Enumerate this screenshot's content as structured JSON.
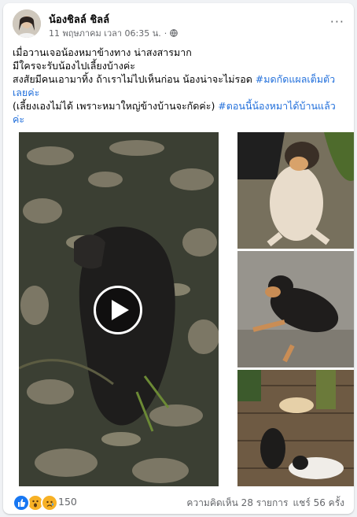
{
  "post": {
    "author": "น้องชิลล์ ชิลล์",
    "timestamp": "11 พฤษภาคม เวลา 06:35 น.",
    "dot": "·",
    "more_label": "···",
    "line1": "เมื่อวานเจอน้องหมาข้างทาง น่าสงสารมาก",
    "line2": "มีใครจะรับน้องไปเลี้ยงบ้างค่ะ",
    "line3_text": "สงสัยมีคนเอามาทิ้ง ถ้าเราไม่ไปเห็นก่อน น้องน่าจะไม่รอด ",
    "line3_tag": "#มดกัดแผลเต็มตัวเลยค่ะ",
    "line4_text": "(เลี้ยงเองไม่ได้ เพราะหมาใหญ่ข้างบ้านจะกัดค่ะ) ",
    "line4_tag": "#ตอนนี้น้องหมาได้บ้านแล้วค่ะ"
  },
  "media": {
    "video_icon": "play-icon",
    "photos": [
      "photo-1",
      "photo-2",
      "photo-3"
    ]
  },
  "footer": {
    "reaction_count": "150",
    "comments": "ความคิดเห็น 28 รายการ",
    "shares": "แชร์ 56 ครั้ง",
    "reaction_colors": [
      "#1877f2",
      "#f7b125",
      "#f7b125"
    ]
  }
}
